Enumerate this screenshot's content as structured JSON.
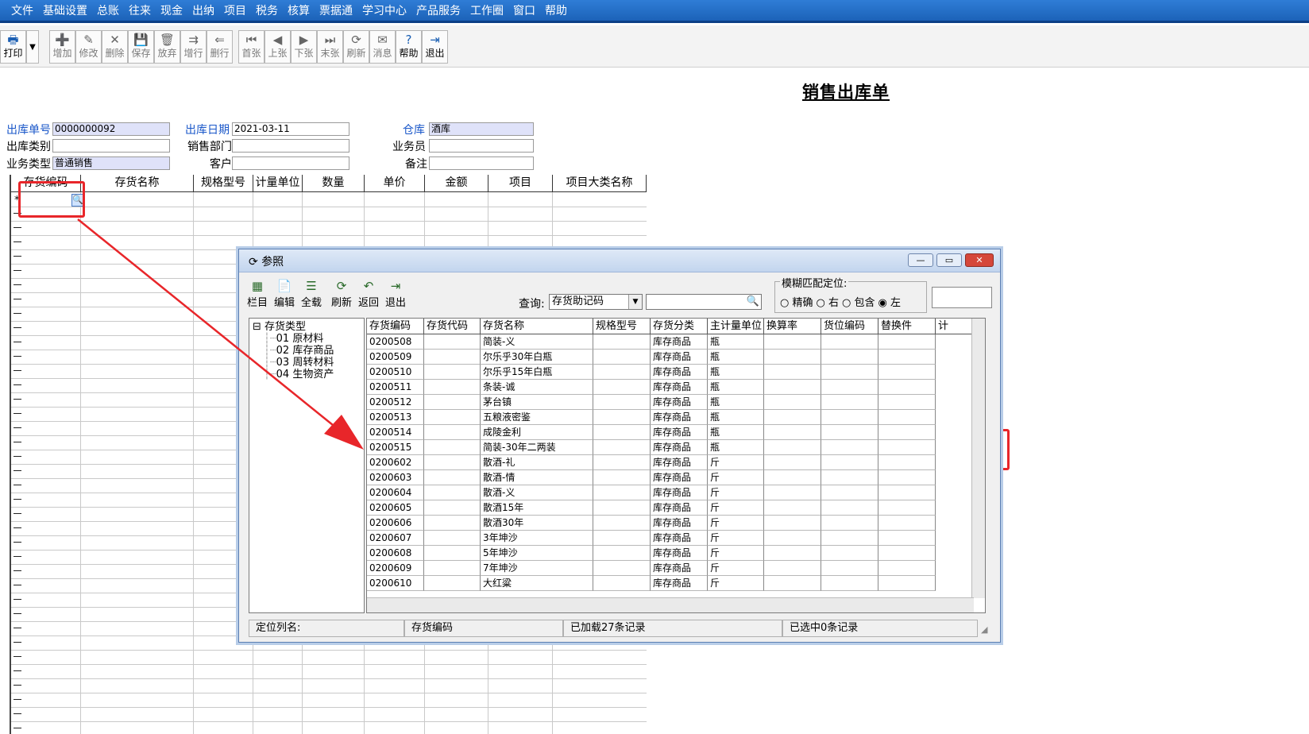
{
  "menu": [
    "文件",
    "基础设置",
    "总账",
    "往来",
    "现金",
    "出纳",
    "项目",
    "税务",
    "核算",
    "票据通",
    "学习中心",
    "产品服务",
    "工作圈",
    "窗口",
    "帮助"
  ],
  "toolbar": {
    "print": "打印",
    "buttons": [
      "增加",
      "修改",
      "删除",
      "保存",
      "放弃",
      "增行",
      "删行",
      "首张",
      "上张",
      "下张",
      "末张",
      "刷新",
      "消息",
      "帮助",
      "退出"
    ]
  },
  "form": {
    "title": "销售出库单",
    "labels": {
      "doc_no": "出库单号",
      "date": "出库日期",
      "warehouse": "仓库",
      "category": "出库类别",
      "dept": "销售部门",
      "salesman": "业务员",
      "biz_type": "业务类型",
      "customer": "客户",
      "note": "备注"
    },
    "values": {
      "doc_no": "0000000092",
      "date": "2021-03-11",
      "warehouse": "酒库",
      "category": "",
      "dept": "",
      "salesman": "",
      "biz_type": "普通销售",
      "customer": "",
      "note": ""
    }
  },
  "main_grid": {
    "columns": [
      "存货编码",
      "存货名称",
      "规格型号",
      "计量单位",
      "数量",
      "单价",
      "金额",
      "项目",
      "项目大类名称"
    ],
    "new_row_marker": "*"
  },
  "dialog": {
    "title": "参照",
    "toolbar": [
      "栏目",
      "编辑",
      "全载",
      "刷新",
      "返回",
      "退出"
    ],
    "query_label": "查询:",
    "query_field": "存货助记码",
    "query_value": "",
    "fuzzy_title": "模糊匹配定位:",
    "fuzzy_options": [
      "精确",
      "右",
      "包含",
      "左"
    ],
    "fuzzy_selected": "左",
    "tree": {
      "root": "存货类型",
      "children": [
        "01 原材料",
        "02 库存商品",
        "03 周转材料",
        "04 生物资产"
      ]
    },
    "columns": [
      "存货编码",
      "存货代码",
      "存货名称",
      "规格型号",
      "存货分类",
      "主计量单位",
      "换算率",
      "货位编码",
      "替换件",
      "计"
    ],
    "rows": [
      [
        "0200508",
        "",
        "简装-义",
        "",
        "库存商品",
        "瓶"
      ],
      [
        "0200509",
        "",
        "尔乐乎30年白瓶",
        "",
        "库存商品",
        "瓶"
      ],
      [
        "0200510",
        "",
        "尔乐乎15年白瓶",
        "",
        "库存商品",
        "瓶"
      ],
      [
        "0200511",
        "",
        "条装-诚",
        "",
        "库存商品",
        "瓶"
      ],
      [
        "0200512",
        "",
        "茅台镇",
        "",
        "库存商品",
        "瓶"
      ],
      [
        "0200513",
        "",
        "五粮液密鉴",
        "",
        "库存商品",
        "瓶"
      ],
      [
        "0200514",
        "",
        "成陵金利",
        "",
        "库存商品",
        "瓶"
      ],
      [
        "0200515",
        "",
        "简装-30年二两装",
        "",
        "库存商品",
        "瓶"
      ],
      [
        "0200602",
        "",
        "散酒-礼",
        "",
        "库存商品",
        "斤"
      ],
      [
        "0200603",
        "",
        "散酒-情",
        "",
        "库存商品",
        "斤"
      ],
      [
        "0200604",
        "",
        "散酒-义",
        "",
        "库存商品",
        "斤"
      ],
      [
        "0200605",
        "",
        "散酒15年",
        "",
        "库存商品",
        "斤"
      ],
      [
        "0200606",
        "",
        "散酒30年",
        "",
        "库存商品",
        "斤"
      ],
      [
        "0200607",
        "",
        "3年坤沙",
        "",
        "库存商品",
        "斤"
      ],
      [
        "0200608",
        "",
        "5年坤沙",
        "",
        "库存商品",
        "斤"
      ],
      [
        "0200609",
        "",
        "7年坤沙",
        "",
        "库存商品",
        "斤"
      ],
      [
        "0200610",
        "",
        "大红粱",
        "",
        "库存商品",
        "斤"
      ]
    ],
    "status": {
      "locate_label": "定位列名:",
      "locate_value": "存货编码",
      "loaded": "已加载27条记录",
      "selected": "已选中0条记录"
    }
  },
  "colors": {
    "menubar": "#1c62b8",
    "highlight": "#e8262a",
    "field_label_blue": "#1a57c9",
    "readonly_field": "#dfe2f9"
  }
}
